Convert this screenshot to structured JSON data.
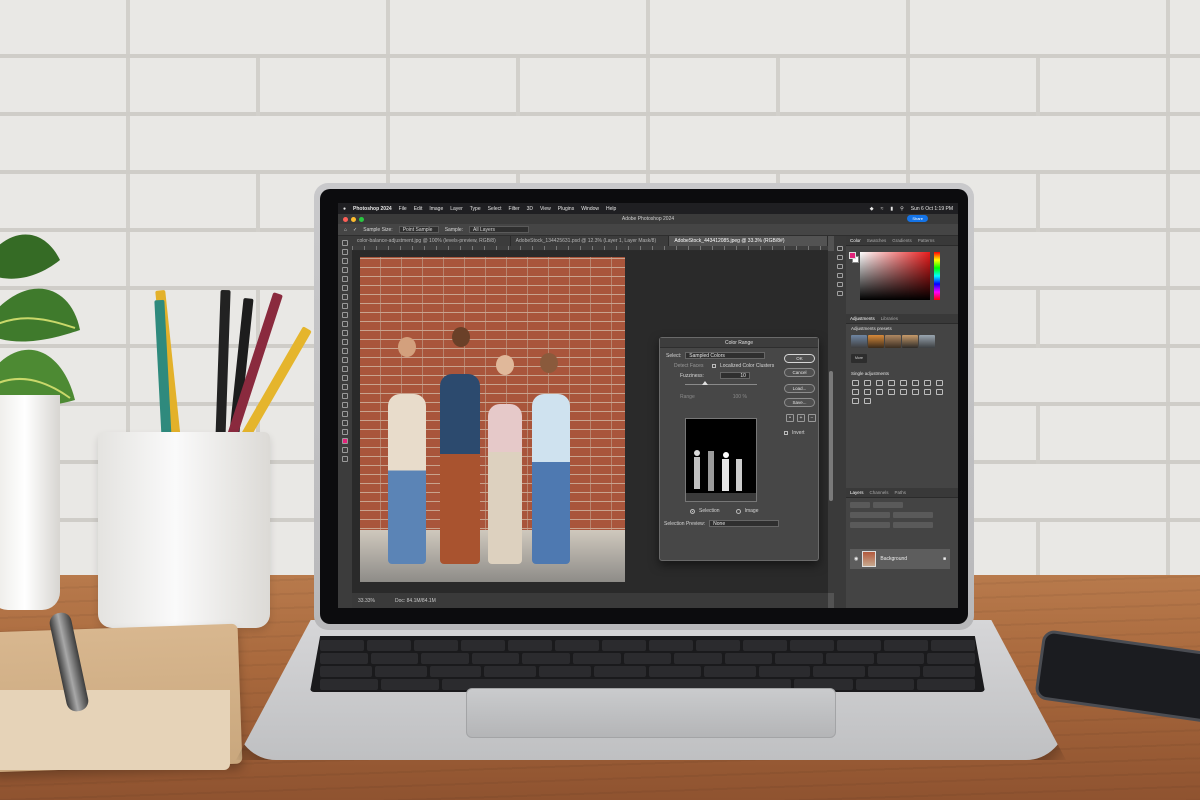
{
  "menubar": {
    "app_name": "Photoshop 2024",
    "menus": [
      "File",
      "Edit",
      "Image",
      "Layer",
      "Type",
      "Select",
      "Filter",
      "3D",
      "View",
      "Plugins",
      "Window",
      "Help"
    ],
    "clock": "Sun 6 Oct 1:19 PM"
  },
  "window": {
    "title": "Adobe Photoshop 2024",
    "share_label": "Share"
  },
  "options_bar": {
    "sample_size_label": "Sample Size:",
    "sample_size_value": "Point Sample",
    "sample_label": "Sample:",
    "sample_value": "All Layers"
  },
  "doc_tabs": [
    {
      "label": "color-balance-adjustment.jpg @ 100% (levels-preview, RGB/8)",
      "active": false
    },
    {
      "label": "AdobeStock_134425631.psd @ 12.3% (Layer 1, Layer Mask/8)",
      "active": false
    },
    {
      "label": "AdobeStock_443412085.jpeg @ 33.3% (RGB/8#)",
      "active": true
    }
  ],
  "status_bar": {
    "zoom": "33.33%",
    "doc_info": "Doc: 84.1M/84.1M"
  },
  "dialog": {
    "title": "Color Range",
    "select_label": "Select:",
    "select_value": "Sampled Colors",
    "detect_faces_label": "Detect Faces",
    "localized_label": "Localized Color Clusters",
    "fuzziness_label": "Fuzziness:",
    "fuzziness_value": "10",
    "range_label": "Range",
    "range_value": "100 %",
    "buttons": {
      "ok": "OK",
      "cancel": "Cancel",
      "load": "Load...",
      "save": "Save..."
    },
    "invert_label": "Invert",
    "radio_selection": "Selection",
    "radio_image": "Image",
    "selection_preview_label": "Selection Preview:",
    "selection_preview_value": "None"
  },
  "color_panel": {
    "tabs": [
      "Color",
      "Swatches",
      "Gradients",
      "Patterns"
    ],
    "foreground": "#e2237a"
  },
  "adjustments_panel": {
    "tabs": [
      "Adjustments",
      "Libraries"
    ],
    "presets_label": "Adjustments presets",
    "more_label": "More",
    "single_label": "Single adjustments"
  },
  "layers_panel": {
    "tabs": [
      "Layers",
      "Channels",
      "Paths"
    ],
    "layer_name": "Background"
  }
}
